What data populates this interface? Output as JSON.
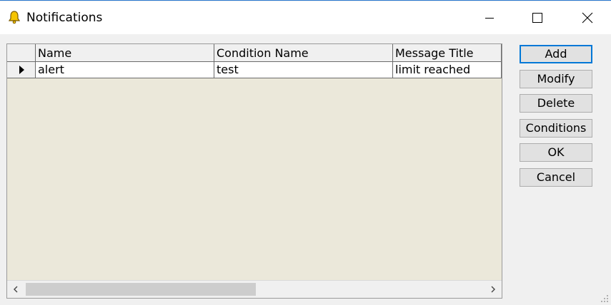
{
  "window": {
    "title": "Notifications",
    "icon": "bell-icon",
    "controls": [
      "minimize-icon",
      "maximize-icon",
      "close-icon"
    ]
  },
  "grid": {
    "columns": [
      "Name",
      "Condition Name",
      "Message Title"
    ],
    "rows": [
      {
        "name": "alert",
        "condition": "test",
        "message_title": "limit reached"
      }
    ]
  },
  "buttons": {
    "add": "Add",
    "modify": "Modify",
    "delete": "Delete",
    "conditions": "Conditions",
    "ok": "OK",
    "cancel": "Cancel"
  },
  "colors": {
    "accent": "#0078d7",
    "grid_background": "#ebe8da",
    "bell": "#e8b400"
  }
}
